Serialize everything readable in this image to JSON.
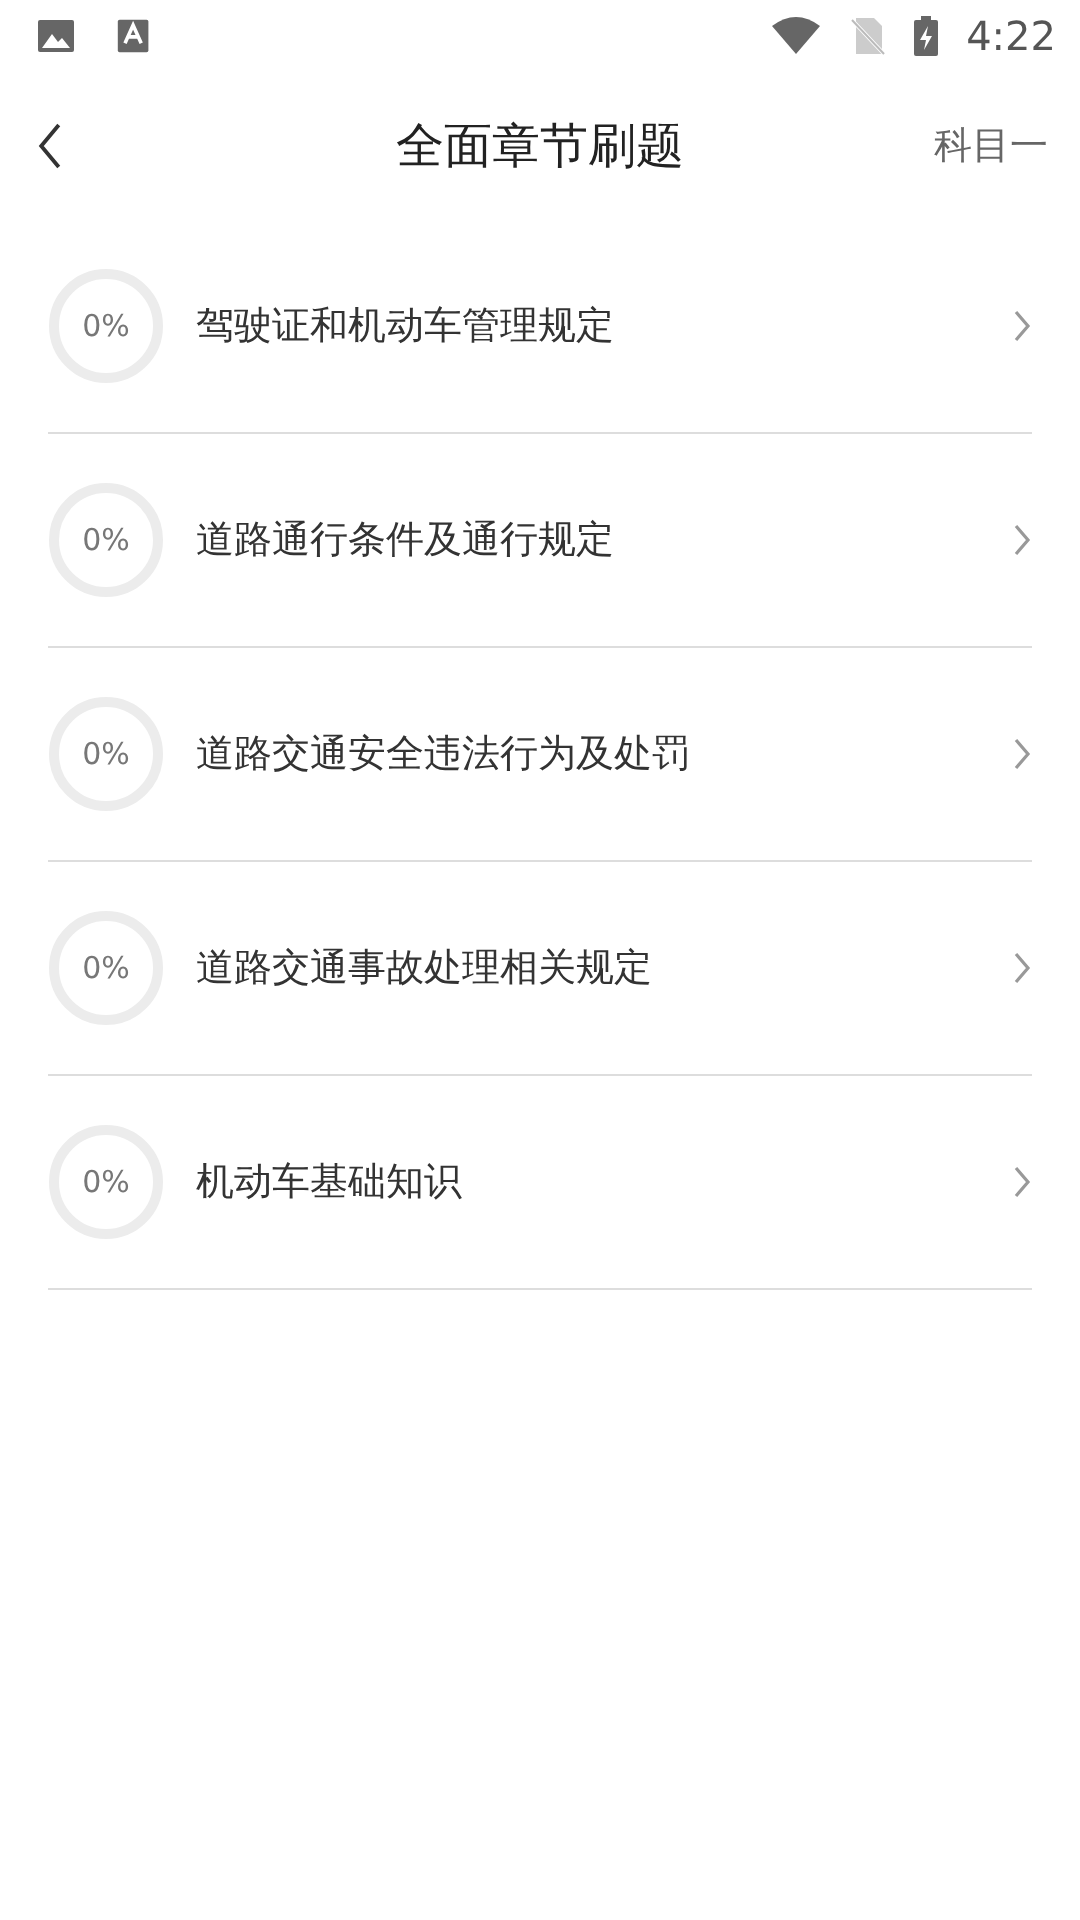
{
  "status_bar": {
    "time": "4:22"
  },
  "header": {
    "title": "全面章节刷题",
    "action": "科目一"
  },
  "chapters": [
    {
      "progress": "0%",
      "level": 0,
      "title": "驾驶证和机动车管理规定"
    },
    {
      "progress": "0%",
      "level": 0,
      "title": "道路通行条件及通行规定"
    },
    {
      "progress": "0%",
      "level": 0,
      "title": "道路交通安全违法行为及处罚"
    },
    {
      "progress": "0%",
      "level": 0,
      "title": "道路交通事故处理相关规定"
    },
    {
      "progress": "0%",
      "level": 0,
      "title": "机动车基础知识"
    }
  ]
}
